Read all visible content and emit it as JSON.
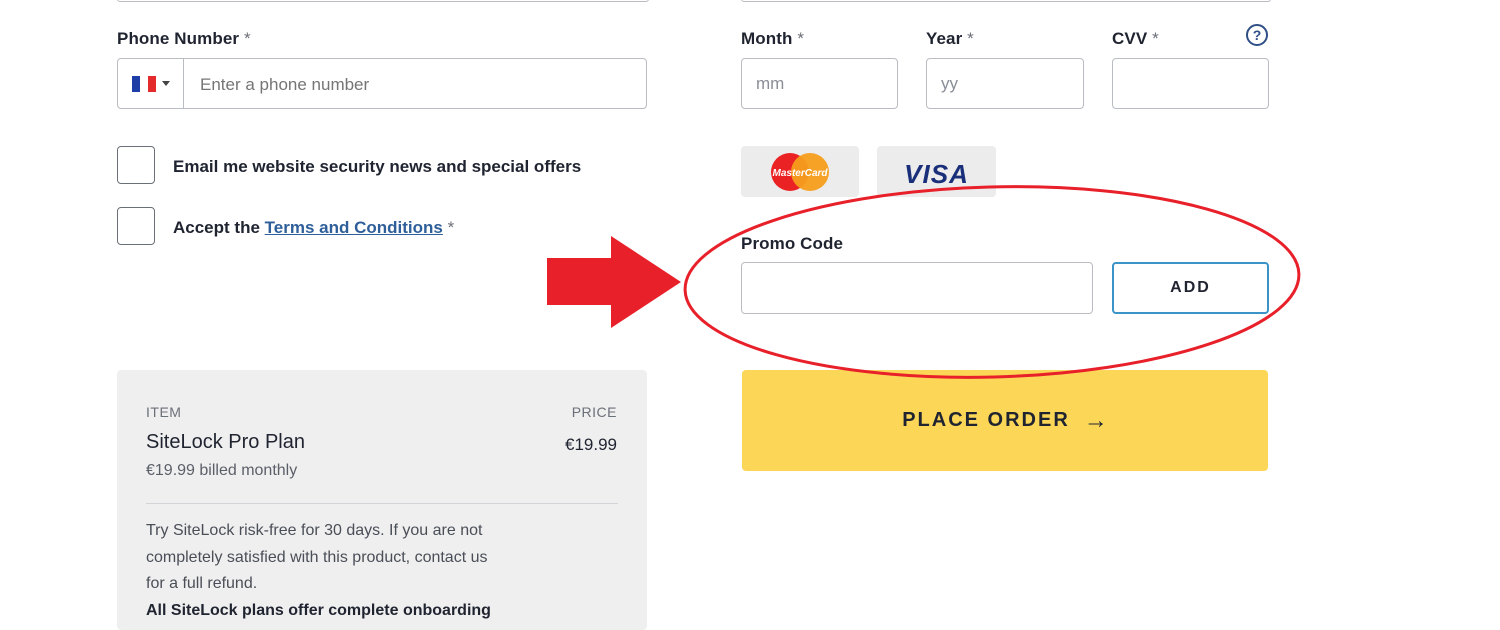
{
  "phone": {
    "label": "Phone Number",
    "required_mark": "*",
    "placeholder": "Enter a phone number",
    "country_flag": "france-flag-icon"
  },
  "expiry": {
    "month_label": "Month",
    "month_placeholder": "mm",
    "year_label": "Year",
    "year_placeholder": "yy",
    "cvv_label": "CVV",
    "required_mark": "*",
    "help_symbol": "?"
  },
  "checkboxes": {
    "email_offers": "Email me website security news and special offers",
    "accept_prefix": "Accept the",
    "terms_link": "Terms and Conditions",
    "required_mark": "*"
  },
  "cards": {
    "mastercard_text": "MasterCard",
    "visa_text": "VISA"
  },
  "promo": {
    "label": "Promo Code",
    "add_button": "ADD"
  },
  "order_button": {
    "label": "PLACE ORDER",
    "arrow": "→"
  },
  "summary": {
    "item_header": "ITEM",
    "price_header": "PRICE",
    "item_name": "SiteLock Pro Plan",
    "billing": "€19.99 billed monthly",
    "price": "€19.99",
    "guarantee_line1": "Try SiteLock risk-free for 30 days. If you are not",
    "guarantee_line2": "completely satisfied with this product, contact us",
    "guarantee_line3": "for a full refund.",
    "guarantee_bold": "All SiteLock plans offer complete onboarding"
  },
  "colors": {
    "annotation_red": "#e8202a",
    "order_yellow": "#fcd757",
    "add_border": "#3b93c8",
    "link_blue": "#2f5f9a"
  }
}
